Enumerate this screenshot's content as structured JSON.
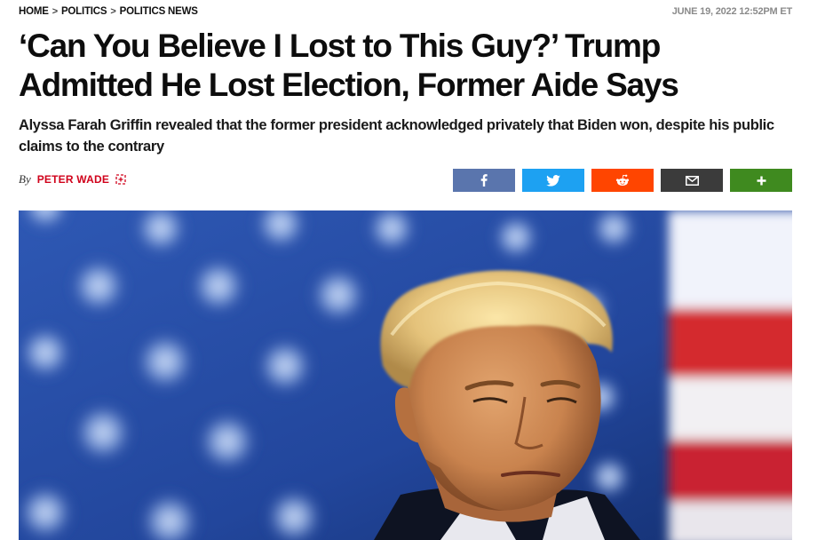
{
  "breadcrumb": {
    "items": [
      "HOME",
      "POLITICS",
      "POLITICS NEWS"
    ],
    "separator": ">"
  },
  "timestamp": "JUNE 19, 2022 12:52PM ET",
  "headline": "‘Can You Believe I Lost to This Guy?’ Trump Admitted He Lost Election, Former Aide Says",
  "dek": "Alyssa Farah Griffin revealed that the former president acknowledged privately that Biden won, despite his public claims to the contrary",
  "byline": {
    "by": "By",
    "author": "PETER WADE"
  },
  "share": [
    {
      "name": "facebook",
      "color": "#5a75ad",
      "icon": "facebook-icon"
    },
    {
      "name": "twitter",
      "color": "#1da1f2",
      "icon": "twitter-icon"
    },
    {
      "name": "reddit",
      "color": "#ff4500",
      "icon": "reddit-icon"
    },
    {
      "name": "email",
      "color": "#3b3b3b",
      "icon": "envelope-icon"
    },
    {
      "name": "more",
      "color": "#3f8a1f",
      "icon": "plus-icon"
    }
  ],
  "colors": {
    "accent": "#d0021b",
    "hero_blue": "#1e3d8f"
  }
}
